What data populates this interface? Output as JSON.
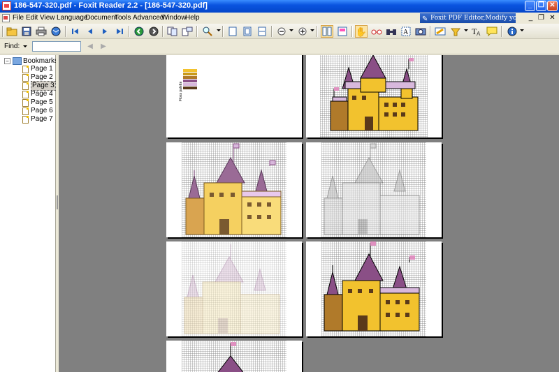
{
  "window": {
    "title": "186-547-320.pdf - Foxit Reader 2.2 - [186-547-320.pdf]",
    "minimize_icon": "minimize-icon",
    "maximize_icon": "maximize-icon",
    "close_icon": "close-icon"
  },
  "menu": {
    "items": [
      "File",
      "Edit",
      "View",
      "Language",
      "Document",
      "Tools",
      "Advanced",
      "Window",
      "Help"
    ],
    "promo": "Foxit PDF Editor,Modify your PDF!"
  },
  "toolbar": {
    "buttons": [
      "open-icon",
      "save-icon",
      "print-icon",
      "email-icon",
      "first-page-icon",
      "previous-page-icon",
      "next-page-icon",
      "last-page-icon",
      "back-icon",
      "forward-icon",
      "copy-page-icon",
      "rotate-icon",
      "zoom-icon",
      "actual-size-icon",
      "fit-page-icon",
      "fit-width-icon",
      "zoom-out-icon",
      "zoom-in-icon",
      "layout-icon",
      "continuous-icon",
      "hand-tool-icon",
      "glasses-icon",
      "find-icon",
      "text-select-icon",
      "snapshot-icon",
      "highlight-icon",
      "typewriter-icon",
      "text-icon",
      "note-icon",
      "info-icon"
    ]
  },
  "find": {
    "label": "Find:",
    "value": ""
  },
  "bookmarks": {
    "root": "Bookmarks",
    "items": [
      "Page 1",
      "Page 2",
      "Page 3",
      "Page 4",
      "Page 5",
      "Page 6",
      "Page 7"
    ],
    "selected": "Page 3"
  },
  "document": {
    "page1_palette_label": "Floss palette",
    "accent_colors": {
      "castle_yellow": "#f2c22e",
      "castle_dark_yellow": "#c99a1a",
      "castle_brown": "#b07a2a",
      "roof_purple": "#8a4f86",
      "roof_lilac": "#d8b8dc",
      "flag_pink": "#e090c0",
      "window_brown": "#5a3a1a"
    }
  }
}
